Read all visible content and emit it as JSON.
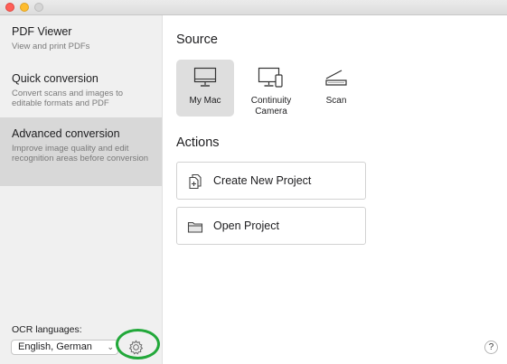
{
  "window": {
    "traffic_lights": [
      "close",
      "minimize",
      "zoom"
    ]
  },
  "sidebar": {
    "items": [
      {
        "title": "PDF Viewer",
        "description": "View and print PDFs",
        "selected": false
      },
      {
        "title": "Quick conversion",
        "description": "Convert scans and images to editable formats and PDF",
        "selected": false
      },
      {
        "title": "Advanced conversion",
        "description": "Improve image quality and edit recognition areas before conversion",
        "selected": true
      }
    ],
    "ocr": {
      "label": "OCR languages:",
      "value": "English, German",
      "chevron": "⌄"
    }
  },
  "main": {
    "source_heading": "Source",
    "sources": [
      {
        "label": "My Mac",
        "icon": "monitor-icon",
        "selected": true
      },
      {
        "label": "Continuity Camera",
        "icon": "continuity-camera-icon",
        "selected": false
      },
      {
        "label": "Scan",
        "icon": "scanner-icon",
        "selected": false
      }
    ],
    "actions_heading": "Actions",
    "actions": [
      {
        "label": "Create New Project",
        "icon": "new-project-icon"
      },
      {
        "label": "Open Project",
        "icon": "folder-icon"
      }
    ]
  },
  "help": {
    "label": "?"
  },
  "colors": {
    "highlight_ring": "#22a83a",
    "selected_bg": "#dedede",
    "sidebar_bg": "#f0f0f0"
  }
}
